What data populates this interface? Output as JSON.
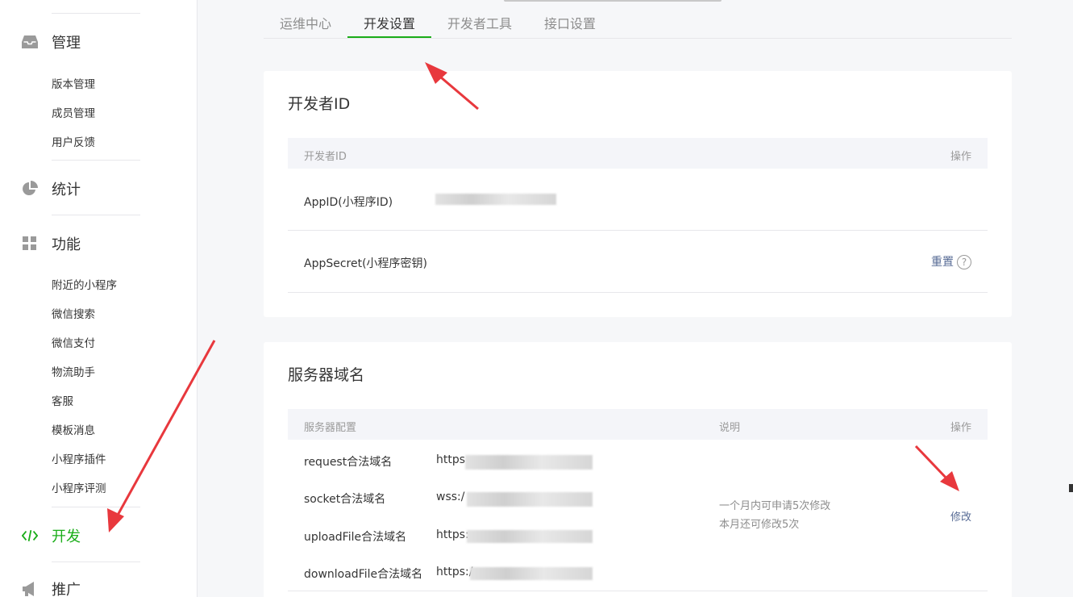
{
  "sidebar": {
    "sections": [
      {
        "label": "管理",
        "icon": "inbox-icon"
      },
      {
        "label": "统计",
        "icon": "pie-chart-icon"
      },
      {
        "label": "功能",
        "icon": "grid-icon"
      },
      {
        "label": "开发",
        "icon": "code-icon"
      },
      {
        "label": "推广",
        "icon": "megaphone-icon"
      }
    ],
    "manage_items": [
      "版本管理",
      "成员管理",
      "用户反馈"
    ],
    "function_items": [
      "附近的小程序",
      "微信搜索",
      "微信支付",
      "物流助手",
      "客服",
      "模板消息",
      "小程序插件",
      "小程序评测"
    ]
  },
  "tabs": [
    "运维中心",
    "开发设置",
    "开发者工具",
    "接口设置"
  ],
  "developer_id": {
    "title": "开发者ID",
    "header_col1": "开发者ID",
    "header_col2": "操作",
    "appid_label": "AppID(小程序ID)",
    "appsecret_label": "AppSecret(小程序密钥)",
    "reset_label": "重置",
    "help_glyph": "?"
  },
  "server_domain": {
    "title": "服务器域名",
    "header_col1": "服务器配置",
    "header_col2": "说明",
    "header_col3": "操作",
    "rows": [
      {
        "label": "request合法域名",
        "value": "https"
      },
      {
        "label": "socket合法域名",
        "value": "wss:/"
      },
      {
        "label": "uploadFile合法域名",
        "value": "https:"
      },
      {
        "label": "downloadFile合法域名",
        "value": "https:/"
      }
    ],
    "note_line1": "一个月内可申请5次修改",
    "note_line2": "本月还可修改5次",
    "modify_label": "修改"
  },
  "colors": {
    "accent": "#1aad19",
    "link": "#576b95",
    "arrow": "#e8383d"
  }
}
